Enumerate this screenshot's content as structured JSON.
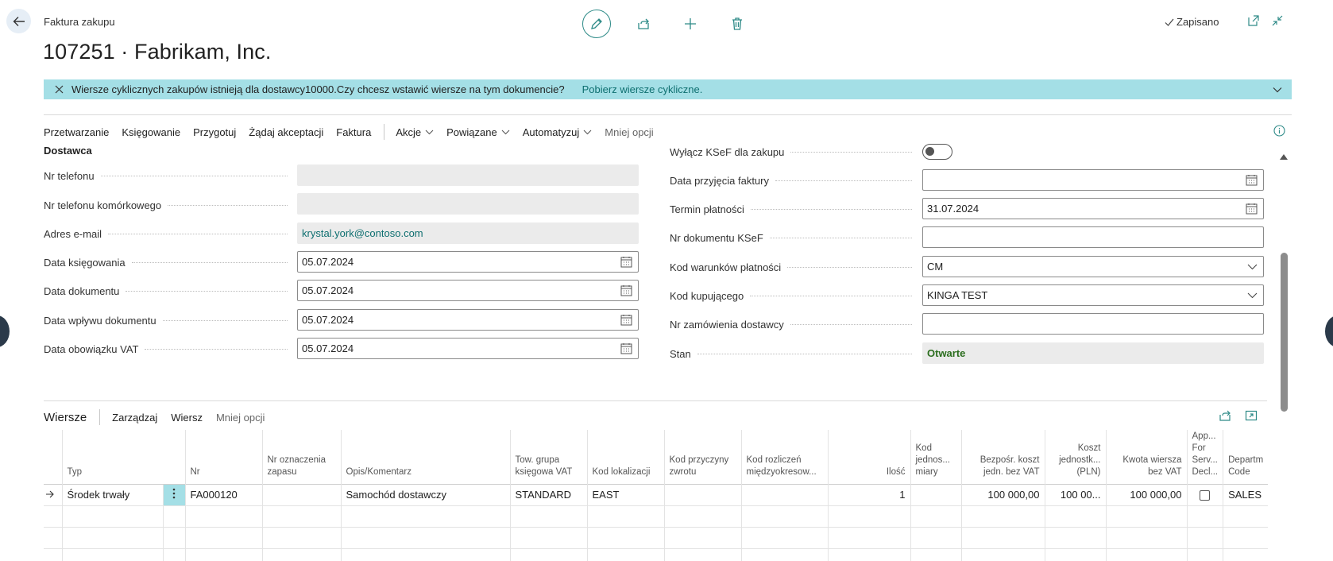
{
  "header": {
    "pre_title": "Faktura zakupu",
    "title": "107251 · Fabrikam, Inc.",
    "saved_label": "Zapisano"
  },
  "banner": {
    "message": "Wiersze cyklicznych zakupów istnieją dla dostawcy10000.Czy chcesz wstawić wiersze na tym dokumencie?",
    "link": "Pobierz wiersze cykliczne."
  },
  "actions": {
    "items": [
      "Przetwarzanie",
      "Księgowanie",
      "Przygotuj",
      "Żądaj akceptacji",
      "Faktura"
    ],
    "menus": [
      "Akcje",
      "Powiązane",
      "Automatyzuj"
    ],
    "less": "Mniej opcji"
  },
  "vendor_section": {
    "heading": "Dostawca",
    "phone_label": "Nr telefonu",
    "mobile_label": "Nr telefonu komórkowego",
    "email_label": "Adres e-mail",
    "email_value": "krystal.york@contoso.com",
    "posting_date_label": "Data księgowania",
    "posting_date": "05.07.2024",
    "doc_date_label": "Data dokumentu",
    "doc_date": "05.07.2024",
    "receipt_date_label": "Data wpływu dokumentu",
    "receipt_date": "05.07.2024",
    "vat_date_label": "Data obowiązku VAT",
    "vat_date": "05.07.2024"
  },
  "right_fields": {
    "ksef_off_label": "Wyłącz KSeF dla zakupu",
    "ksef_off": false,
    "invoice_receipt_label": "Data przyjęcia faktury",
    "invoice_receipt_value": "",
    "due_date_label": "Termin płatności",
    "due_date": "31.07.2024",
    "ksef_doc_label": "Nr dokumentu KSeF",
    "ksef_doc_value": "",
    "payment_terms_label": "Kod warunków płatności",
    "payment_terms": "CM",
    "purchaser_label": "Kod kupującego",
    "purchaser": "KINGA TEST",
    "vendor_order_label": "Nr zamówienia dostawcy",
    "vendor_order_value": "",
    "status_label": "Stan",
    "status": "Otwarte"
  },
  "lines": {
    "title": "Wiersze",
    "manage": "Zarządzaj",
    "line": "Wiersz",
    "less": "Mniej opcji",
    "columns": {
      "type": "Typ",
      "no": "Nr",
      "item_ref": "Nr oznaczenia zapasu",
      "desc": "Opis/Komentarz",
      "vat_group": "Tow. grupa księgowa VAT",
      "location": "Kod lokalizacji",
      "return_reason": "Kod przyczyny zwrotu",
      "deferral": "Kod rozliczeń międzyokresow...",
      "qty": "Ilość",
      "uom": "Kod jednos... miary",
      "direct_cost": "Bezpośr. koszt jedn. bez VAT",
      "unit_cost_pln": "Koszt jednostk... (PLN)",
      "line_amount": "Kwota wiersza bez VAT",
      "app_for_serv": "App... For Serv... Decl...",
      "dept": "Departm Code"
    },
    "rows": [
      {
        "type": "Środek trwały",
        "no": "FA000120",
        "item_ref": "",
        "desc": "Samochód dostawczy",
        "vat_group": "STANDARD",
        "location": "EAST",
        "return_reason": "",
        "deferral": "",
        "qty": "1",
        "uom": "",
        "direct_cost": "100 000,00",
        "unit_cost_pln": "100 00...",
        "line_amount": "100 000,00",
        "dept": "SALES"
      }
    ]
  },
  "colors": {
    "accent": "#0e6f70",
    "banner_bg": "#a4dfe6",
    "status_green": "#2c6e1f"
  }
}
